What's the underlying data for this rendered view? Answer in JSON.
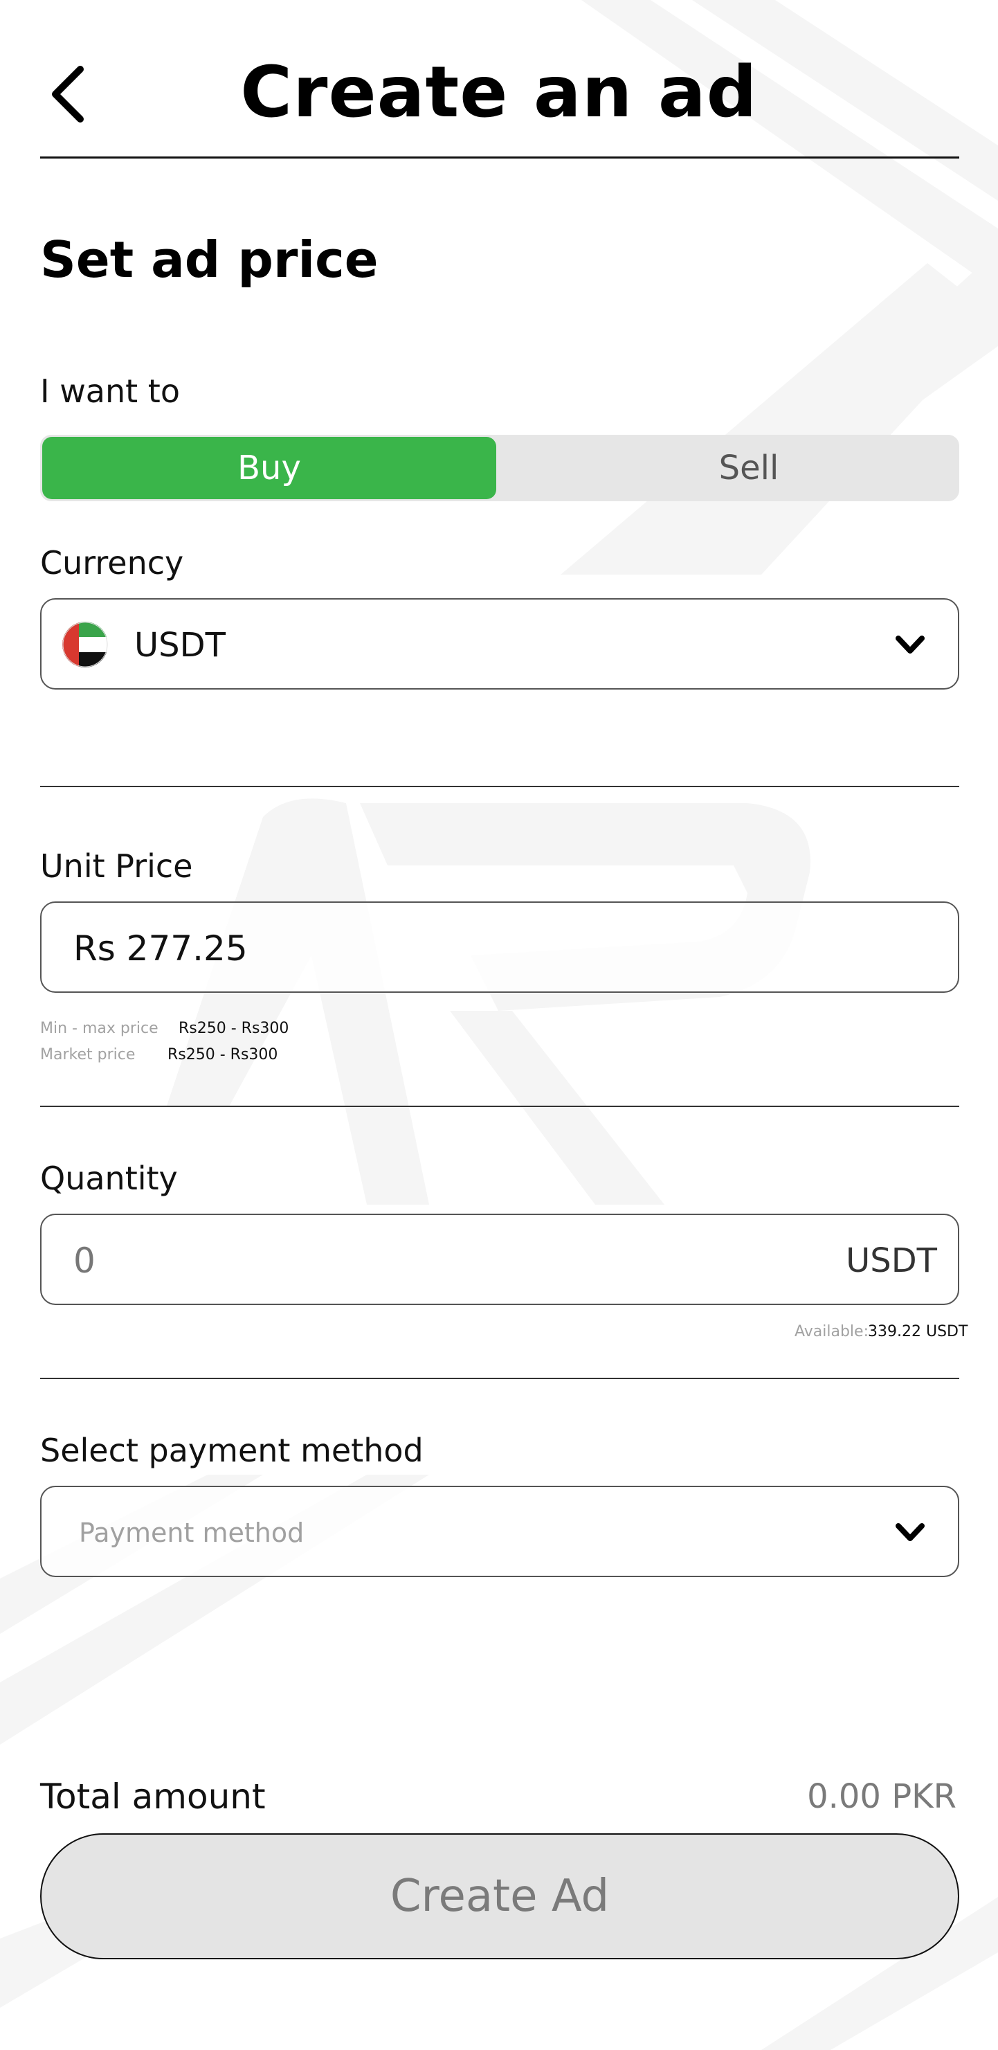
{
  "header": {
    "title": "Create an ad",
    "back_icon": "chevron-left-icon"
  },
  "section": {
    "title": "Set ad price"
  },
  "intent": {
    "label": "I want to",
    "options": [
      "Buy",
      "Sell"
    ],
    "selected": "Buy",
    "active_color": "#3AB54A"
  },
  "currency": {
    "label": "Currency",
    "value": "USDT",
    "flag_icon": "uae-flag-icon",
    "dropdown_icon": "chevron-down-icon"
  },
  "unit_price": {
    "label": "Unit Price",
    "value": "Rs 277.25",
    "min_max_label": "Min - max price",
    "min_max_value": "Rs250 - Rs300",
    "market_label": "Market price",
    "market_value": "Rs250 - Rs300"
  },
  "quantity": {
    "label": "Quantity",
    "value": "0",
    "unit": "USDT",
    "available_label": "Available:",
    "available_value": "339.22 USDT"
  },
  "payment": {
    "label": "Select payment method",
    "placeholder": "Payment method",
    "dropdown_icon": "chevron-down-icon"
  },
  "total": {
    "label": "Total amount",
    "value": "0.00 PKR"
  },
  "submit": {
    "label": "Create Ad"
  }
}
